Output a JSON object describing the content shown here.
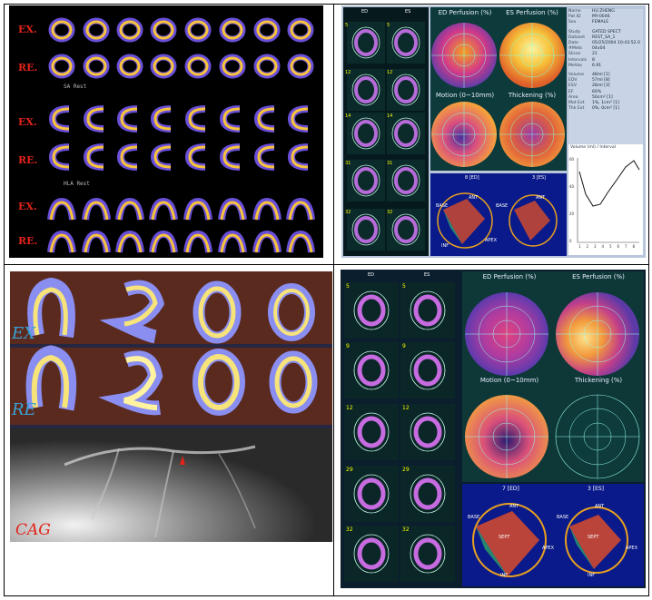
{
  "panelA": {
    "row_labels": [
      "EX.",
      "RE.",
      "EX.",
      "RE.",
      "EX.",
      "RE."
    ],
    "captions": [
      "SA Rest",
      "HLA Rest"
    ]
  },
  "panelB": {
    "col_labels": [
      "ED",
      "ES"
    ],
    "slice_numbers": [
      "5",
      "12",
      "14",
      "31",
      "32"
    ],
    "polar_titles": [
      "ED Perfusion (%)",
      "ES Perfusion (%)",
      "Motion (0~10mm)",
      "Thickening (%)"
    ],
    "info": [
      {
        "k": "Name",
        "v": "HU ZHENG"
      },
      {
        "k": "Pat ID",
        "v": "MY-0046"
      },
      {
        "k": "Sex",
        "v": "FEMALE"
      },
      {
        "k": "Study",
        "v": "GATED SPECT"
      },
      {
        "k": "Dataset",
        "v": "REST_SA_1"
      },
      {
        "k": "Date",
        "v": "05/25/2004 10:43:52.0"
      },
      {
        "k": "#Mets",
        "v": "04x04"
      },
      {
        "k": "Slices",
        "v": "21"
      },
      {
        "k": "Intervals",
        "v": "8"
      },
      {
        "k": "MeVox",
        "v": "6.91"
      },
      {
        "k": "Volume",
        "v": "48ml [1]"
      },
      {
        "k": "EDV",
        "v": "57ml [8]"
      },
      {
        "k": "ESV",
        "v": "28ml [3]"
      },
      {
        "k": "EF",
        "v": "60%"
      },
      {
        "k": "Area",
        "v": "50cm² [1]"
      },
      {
        "k": "Mot Ext",
        "v": "1%, 1cm² [1]"
      },
      {
        "k": "Thk Ext",
        "v": "0%, 0cm² [1]"
      }
    ],
    "graph_title": "Volume (ml) / Interval",
    "x_ticks": [
      "1",
      "2",
      "3",
      "4",
      "5",
      "6",
      "7",
      "8"
    ],
    "y_ticks": [
      "60",
      "40",
      "20",
      "0"
    ],
    "render_labels": [
      "8 [ED]",
      "3 [ES]"
    ],
    "orient": [
      "BASE",
      "ANT",
      "INF",
      "APEX",
      "SEPT"
    ]
  },
  "panelC": {
    "labels": [
      "EX",
      "RE",
      "CAG"
    ]
  },
  "panelD": {
    "col_labels": [
      "ED",
      "ES"
    ],
    "slice_numbers": [
      "5",
      "9",
      "12",
      "29",
      "32"
    ],
    "polar_titles": [
      "ED Perfusion (%)",
      "ES Perfusion (%)",
      "Motion (0~10mm)",
      "Thickening (%)"
    ],
    "render_labels": [
      "7 [ED]",
      "3 [ES]"
    ],
    "orient": [
      "BASE",
      "ANT",
      "SEPT",
      "APEX",
      "INF"
    ]
  }
}
